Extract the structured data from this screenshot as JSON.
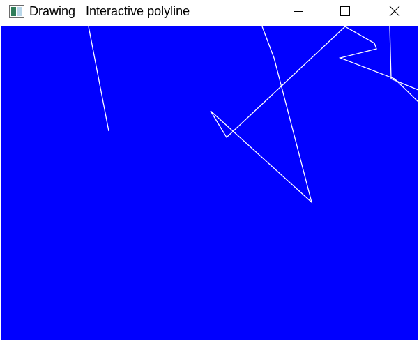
{
  "window": {
    "title": "Drawing   Interactive polyline",
    "controls": {
      "minimize_icon": "minimize-icon",
      "maximize_icon": "maximize-icon",
      "close_icon": "close-icon"
    }
  },
  "canvas": {
    "background_color": "#0000ff",
    "line_color": "#ffffff"
  }
}
